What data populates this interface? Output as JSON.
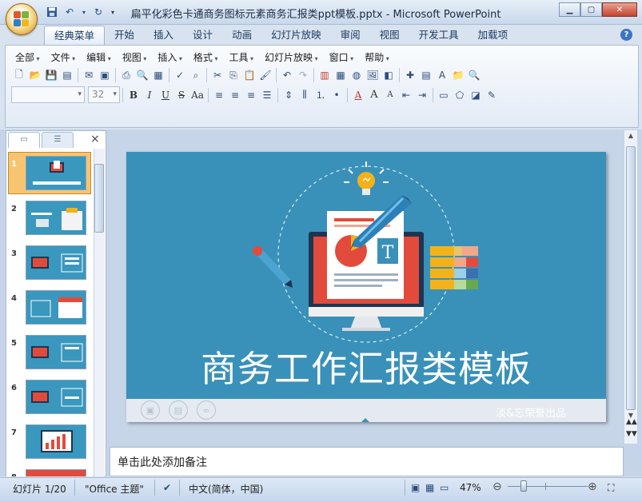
{
  "window": {
    "title": "扁平化彩色卡通商务图标元素商务汇报类ppt模板.pptx - Microsoft PowerPoint",
    "controls": [
      "minimize",
      "maximize",
      "close"
    ]
  },
  "ribbon_tabs": [
    {
      "label": "经典菜单",
      "active": true
    },
    {
      "label": "开始"
    },
    {
      "label": "插入"
    },
    {
      "label": "设计"
    },
    {
      "label": "动画"
    },
    {
      "label": "幻灯片放映"
    },
    {
      "label": "审阅"
    },
    {
      "label": "视图"
    },
    {
      "label": "开发工具"
    },
    {
      "label": "加载项"
    }
  ],
  "classic_menu": [
    "全部",
    "文件",
    "编辑",
    "视图",
    "插入",
    "格式",
    "工具",
    "幻灯片放映",
    "窗口",
    "帮助"
  ],
  "font_size": "32",
  "format_buttons": [
    "B",
    "I",
    "U",
    "S",
    "Aa"
  ],
  "slide_panel": {
    "tabs": [
      "slides-tab",
      "outline-tab"
    ],
    "close": "×",
    "slide_numbers": [
      "1",
      "2",
      "3",
      "4",
      "5",
      "6",
      "7",
      "8"
    ]
  },
  "slide": {
    "title": "商务工作汇报类模板",
    "watermark": "淡&忘荣誉出品",
    "doc_letter": "T",
    "colors": {
      "background": "#3991b9",
      "screen_frame": "#1e3550",
      "red": "#e24b3b",
      "bulb": "#f3b21a"
    }
  },
  "notes": {
    "placeholder": "单击此处添加备注"
  },
  "status": {
    "slide_indicator": "幻灯片 1/20",
    "theme": "\"Office 主题\"",
    "language": "中文(简体，中国)",
    "zoom": "47%"
  }
}
